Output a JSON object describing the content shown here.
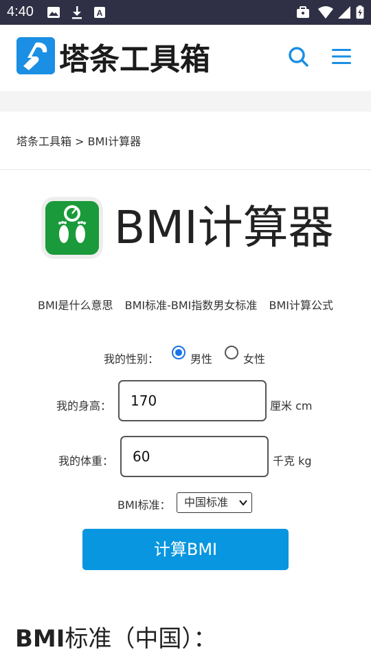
{
  "status": {
    "time": "4:40"
  },
  "header": {
    "logo_text": "塔条工具箱",
    "search_icon": "search-icon",
    "menu_icon": "menu-icon",
    "accent": "#1a8fe3"
  },
  "breadcrumb": "塔条工具箱 > BMI计算器",
  "app": {
    "title": "BMI计算器",
    "icon": "scale-icon",
    "icon_color": "#1a9a3a"
  },
  "links": [
    "BMI是什么意思",
    "BMI标准-BMI指数男女标准",
    "BMI计算公式"
  ],
  "form": {
    "gender_label": "我的性别：",
    "male": "男性",
    "female": "女性",
    "male_selected": true,
    "height_label": "我的身高：",
    "height_value": "170",
    "height_unit": "厘米 cm",
    "weight_label": "我的体重：",
    "weight_value": "60",
    "weight_unit": "千克 kg",
    "standard_label": "BMI标准：",
    "standard_value": "中国标准",
    "button": "计算BMI",
    "button_color": "#0996e0"
  },
  "section": {
    "title_bold": "BMI",
    "title_rest": "标准（中国）："
  }
}
